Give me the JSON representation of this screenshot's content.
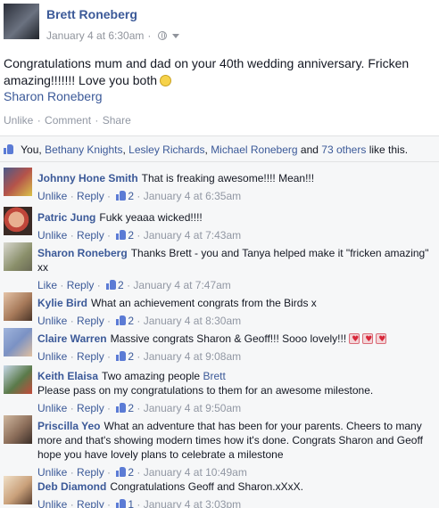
{
  "post": {
    "author": "Brett Roneberg",
    "timestamp": "January 4 at 6:30am",
    "privacy_icon": "globe-icon",
    "text": "Congratulations mum and dad on your 40th wedding anniversary. Fricken amazing!!!!!!! Love you both",
    "emoji": "smile-icon",
    "tagged": "Sharon Roneberg",
    "actions": {
      "unlike": "Unlike",
      "comment": "Comment",
      "share": "Share",
      "dot": "·"
    }
  },
  "likes_bar": {
    "you": "You,",
    "names": [
      "Bethany Knights",
      "Lesley Richards",
      "Michael Roneberg"
    ],
    "and": "and",
    "others": "73 others",
    "suffix": "like this."
  },
  "comments": [
    {
      "name": "Johnny Hone Smith",
      "text": "That is freaking awesome!!!! Mean!!!",
      "action": "Unlike",
      "reply": "Reply",
      "likes": "2",
      "time": "January 4 at 6:35am",
      "avatar_color": "#4a5a8a"
    },
    {
      "name": "Patric Jung",
      "text": "Fukk yeaaa wicked!!!!",
      "action": "Unlike",
      "reply": "Reply",
      "likes": "2",
      "time": "January 4 at 7:43am",
      "avatar_color": "#c0463a"
    },
    {
      "name": "Sharon Roneberg",
      "text": "Thanks Brett - you and Tanya helped make it \"fricken amazing\" xx",
      "action": "Like",
      "reply": "Reply",
      "likes": "2",
      "time": "January 4 at 7:47am",
      "avatar_color": "#8a8f6a"
    },
    {
      "name": "Kylie Bird",
      "text": "What an achievement congrats from the Birds x",
      "action": "Unlike",
      "reply": "Reply",
      "likes": "2",
      "time": "January 4 at 8:30am",
      "avatar_color": "#a77a5a"
    },
    {
      "name": "Claire Warren",
      "text": "Massive congrats Sharon & Geoff!!! Sooo lovely!!!",
      "action": "Unlike",
      "reply": "Reply",
      "likes": "2",
      "time": "January 4 at 9:08am",
      "avatar_color": "#7b92c4",
      "hearts": 3
    },
    {
      "name": "Keith Elaisa",
      "text": "Two amazing people",
      "tag": "Brett",
      "text2": "Please pass on my congratulations to them for an awesome milestone.",
      "action": "Unlike",
      "reply": "Reply",
      "likes": "2",
      "time": "January 4 at 9:50am",
      "avatar_color": "#5a7a4a"
    },
    {
      "name": "Priscilla Yeo",
      "text": "What an adventure that has been for your parents. Cheers to many more and that's showing modern times how it's done. Congrats Sharon and Geoff hope you have lovely plans to celebrate a milestone",
      "action": "Unlike",
      "reply": "Reply",
      "likes": "2",
      "time": "January 4 at 10:49am",
      "avatar_color": "#8c6e5a"
    },
    {
      "name": "Deb Diamond",
      "text": "Congratulations Geoff and Sharon.xXxX.",
      "action": "Unlike",
      "reply": "Reply",
      "likes": "1",
      "time": "January 4 at 3:03pm",
      "avatar_color": "#c9a07a"
    }
  ]
}
